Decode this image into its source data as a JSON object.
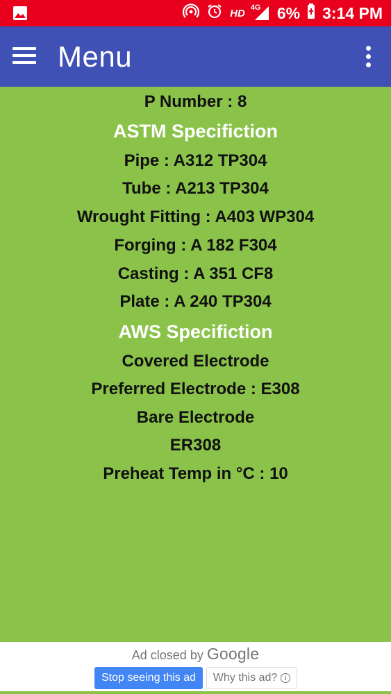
{
  "status_bar": {
    "hd": "HD",
    "network": "4G",
    "battery_percent": "6%",
    "time": "3:14 PM",
    "color": "#e8001c"
  },
  "app_bar": {
    "title": "Menu",
    "color": "#3f51b5"
  },
  "content": {
    "p_number": "P Number : 8",
    "astm_heading": "ASTM Specifiction",
    "pipe": "Pipe : A312 TP304",
    "tube": "Tube : A213 TP304",
    "wrought_fitting": "Wrought Fitting : A403 WP304",
    "forging": "Forging : A 182 F304",
    "casting": "Casting : A 351 CF8",
    "plate": "Plate : A 240 TP304",
    "aws_heading": "AWS Specifiction",
    "covered_electrode": "Covered Electrode",
    "preferred_electrode": "Preferred Electrode : E308",
    "bare_electrode": "Bare Electrode",
    "er": "ER308",
    "preheat": "Preheat Temp in °C : 10",
    "background": "#8bc34a"
  },
  "ad": {
    "closed_text": "Ad closed by",
    "google": "Google",
    "stop_button": "Stop seeing this ad",
    "why_button": "Why this ad?",
    "info_glyph": "i"
  }
}
